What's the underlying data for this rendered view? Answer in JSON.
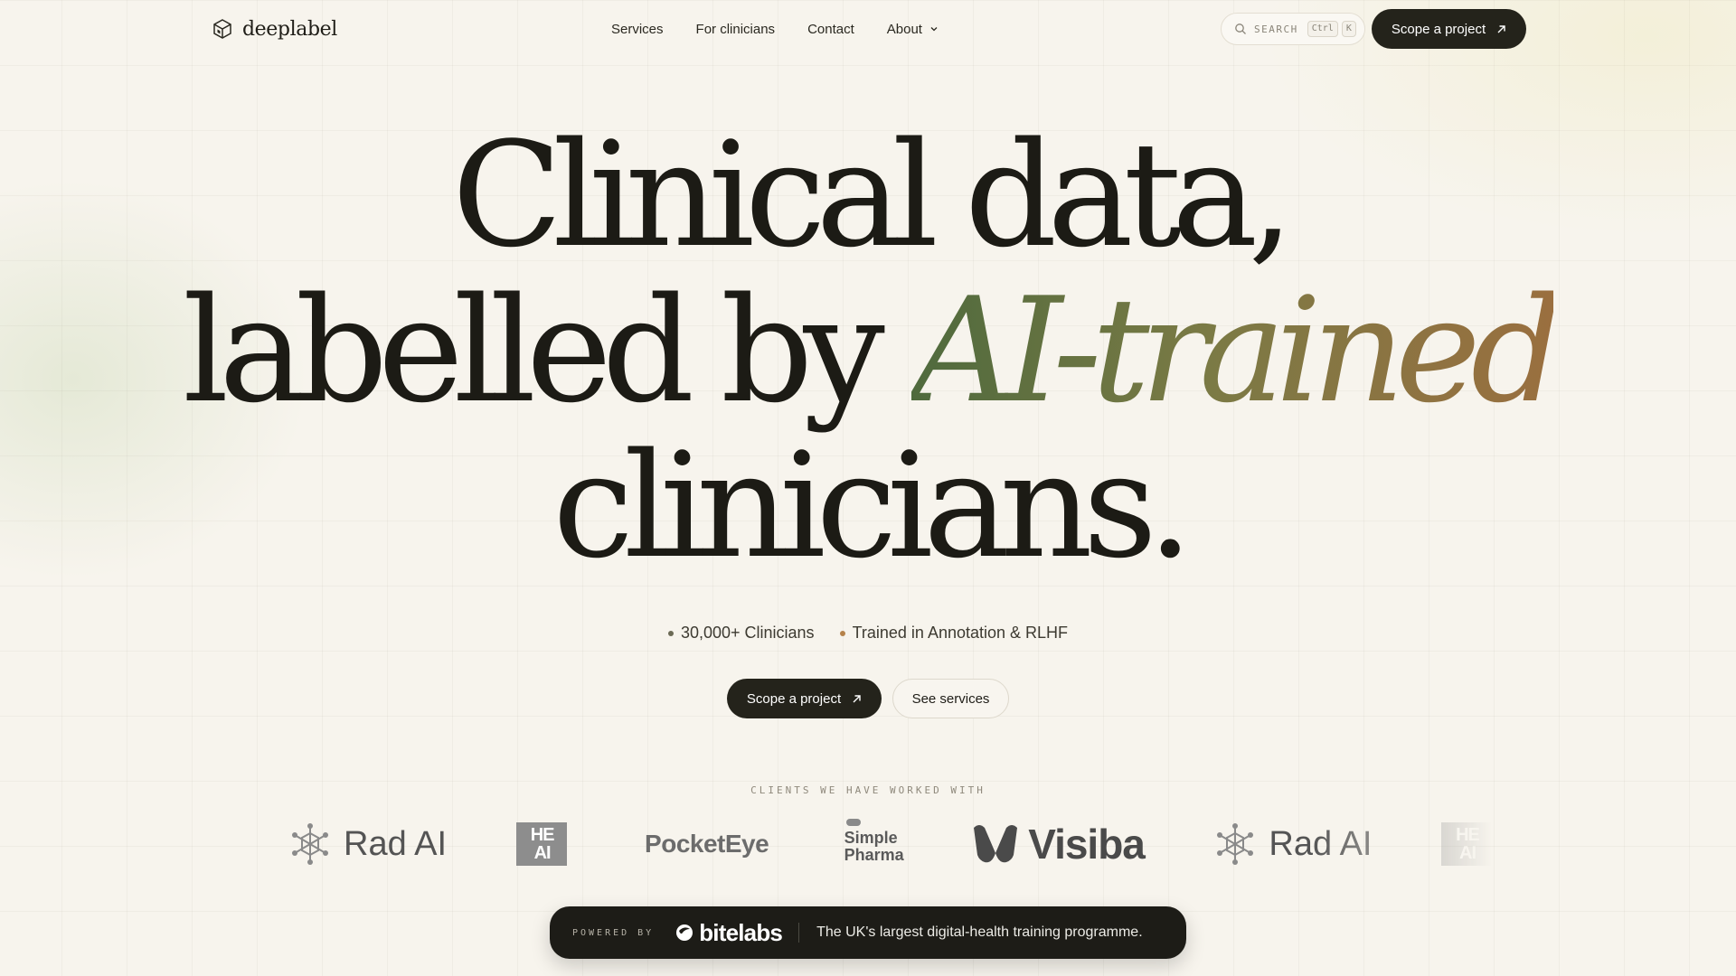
{
  "nav": {
    "brand": "deeplabel",
    "links": [
      "Services",
      "For clinicians",
      "Contact",
      "About"
    ],
    "search_label": "SEARCH",
    "search_keys": [
      "Ctrl",
      "K"
    ],
    "cta": "Scope a project"
  },
  "hero": {
    "line1": "Clinical data,",
    "line2_pre": "labelled by ",
    "line2_accent": "AI-trained",
    "line3": "clinicians.",
    "stats": [
      {
        "text": "30,000+ Clinicians",
        "dot_color": "#6b6a55"
      },
      {
        "text": "Trained in Annotation & RLHF",
        "dot_color": "#b5824a"
      }
    ],
    "primary_cta": "Scope a project",
    "secondary_cta": "See services"
  },
  "clients": {
    "label": "CLIENTS WE HAVE WORKED WITH",
    "logos": [
      {
        "name": "Rad AI",
        "text": "Rad AI"
      },
      {
        "name": "HE AI",
        "lines": [
          "HE",
          "AI"
        ]
      },
      {
        "name": "PocketEye",
        "text": "PocketEye"
      },
      {
        "name": "Simple Pharma",
        "lines": [
          "Simple",
          "Pharma"
        ]
      },
      {
        "name": "Visiba",
        "text": "Visiba"
      },
      {
        "name": "Rad AI",
        "text": "Rad AI"
      },
      {
        "name": "HE AI",
        "lines": [
          "HE",
          "AI"
        ]
      }
    ]
  },
  "powered": {
    "label": "POWERED BY",
    "brand": "bitelabs",
    "tagline": "The UK's largest digital-health training programme."
  },
  "colors": {
    "background": "#f7f4ed",
    "dark": "#24231b",
    "accent_start": "#4f6a3d",
    "accent_end": "#9a6f3f"
  }
}
